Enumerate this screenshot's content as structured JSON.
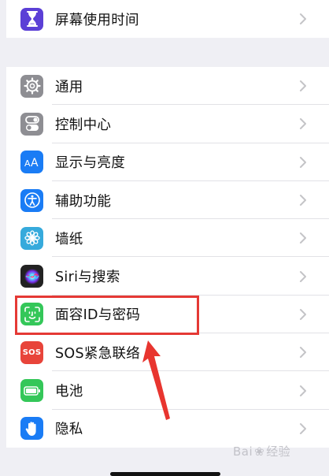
{
  "screen_time": {
    "label": "屏幕使用时间",
    "icon": "hourglass-icon",
    "icon_color": "#5b3fd6"
  },
  "settings": {
    "items": [
      {
        "label": "通用",
        "icon": "gear-icon",
        "icon_color": "#8e8e93"
      },
      {
        "label": "控制中心",
        "icon": "toggles-icon",
        "icon_color": "#8e8e93"
      },
      {
        "label": "显示与亮度",
        "icon": "text-size-icon",
        "icon_color": "#1a7cf5"
      },
      {
        "label": "辅助功能",
        "icon": "accessibility-icon",
        "icon_color": "#1a7cf5"
      },
      {
        "label": "墙纸",
        "icon": "flower-icon",
        "icon_color": "#36aadc"
      },
      {
        "label": "Siri与搜索",
        "icon": "siri-icon",
        "icon_color": "#222222"
      },
      {
        "label": "面容ID与密码",
        "icon": "face-id-icon",
        "icon_color": "#34c759"
      },
      {
        "label": "SOS紧急联络",
        "icon": "sos-icon",
        "icon_color": "#e8443a",
        "icon_text": "SOS"
      },
      {
        "label": "电池",
        "icon": "battery-icon",
        "icon_color": "#34c759"
      },
      {
        "label": "隐私",
        "icon": "hand-icon",
        "icon_color": "#1a7cf5"
      }
    ]
  },
  "watermark": {
    "text_left": "Bai",
    "text_right": "经验"
  },
  "colors": {
    "background": "#efeff4",
    "annotation": "#e53935",
    "chevron": "#c4c4c7"
  }
}
